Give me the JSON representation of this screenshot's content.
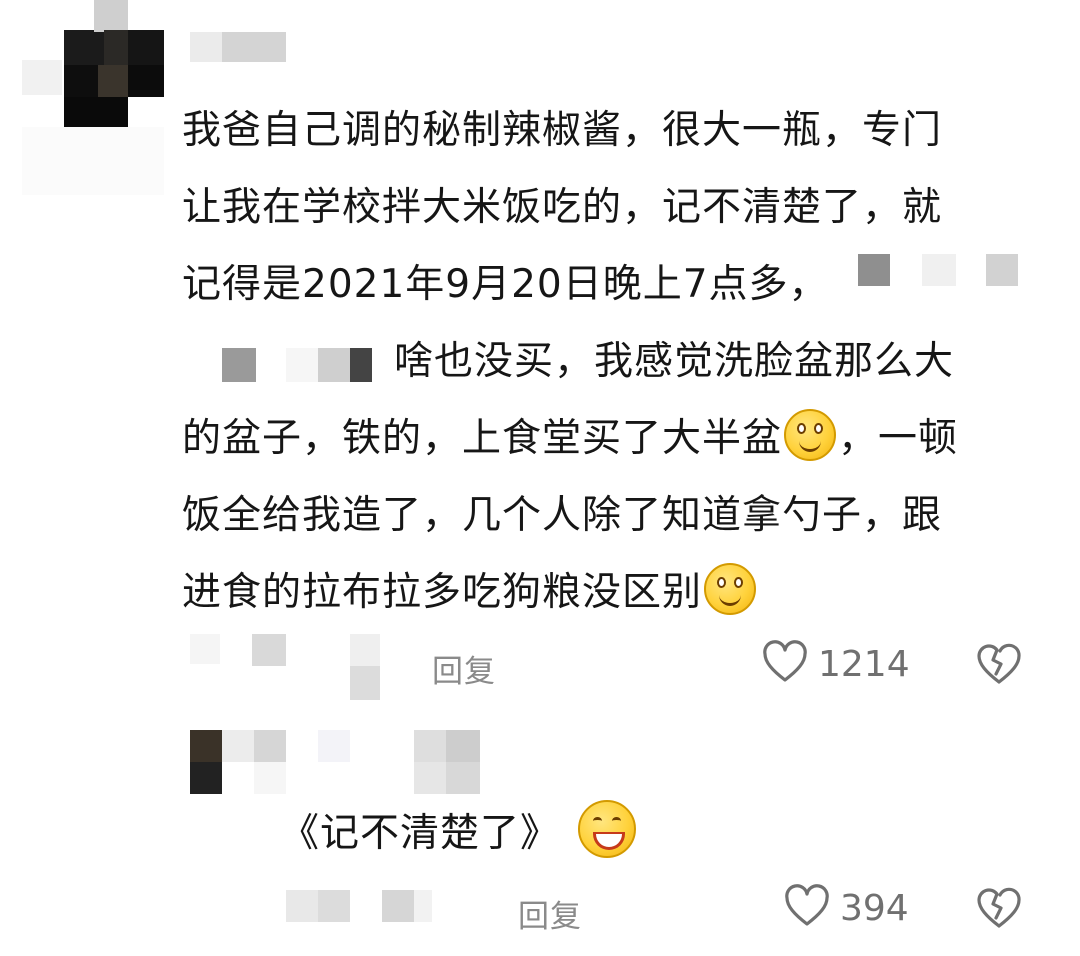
{
  "comment": {
    "lines": [
      "我爸自己调的秘制辣椒酱，很大一瓶，专门",
      "让我在学校拌大米饭吃的，记不清楚了，就",
      "记得是2021年9月20日晚上7点多，",
      "啥也没买，我感觉洗脸盆那么大",
      "的盆子，铁的，上食堂买了大半盆",
      "，一顿",
      "饭全给我造了，几个人除了知道拿勺子，跟",
      "进食的拉布拉多吃狗粮没区别"
    ],
    "reply_label": "回复",
    "like_count": "1214"
  },
  "reply": {
    "text": "《记不清楚了》",
    "reply_label": "回复",
    "like_count": "394"
  },
  "icons": {
    "heart": "heart-outline-icon",
    "dislike": "broken-heart-icon",
    "emoji_smile": "smile-emoji-icon",
    "emoji_laugh": "laugh-emoji-icon"
  },
  "colors": {
    "text": "#161616",
    "secondary": "#8a8a8a",
    "icon": "#707070",
    "emoji": "#ffd23c"
  }
}
